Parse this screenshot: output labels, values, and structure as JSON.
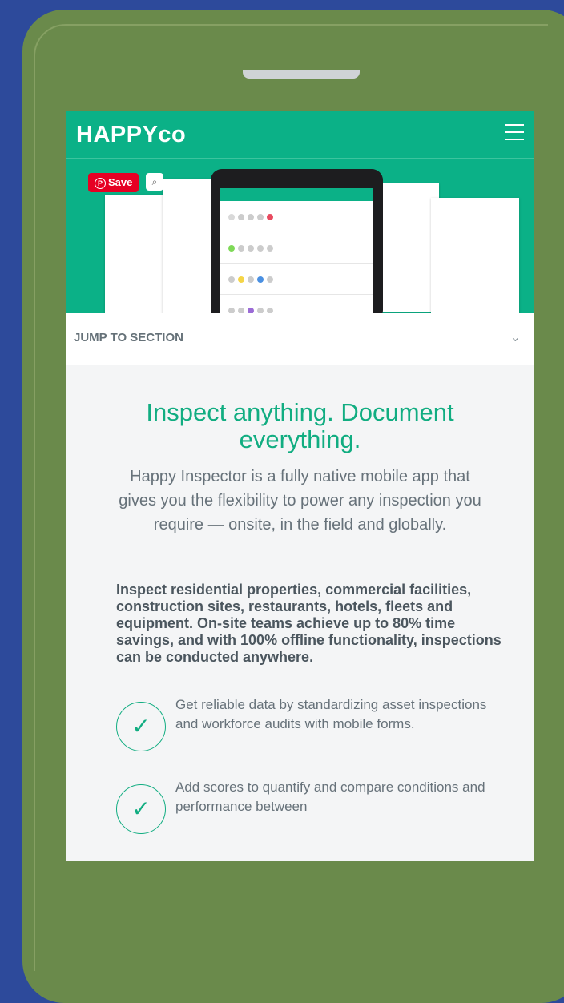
{
  "header": {
    "logo": "HAPPYco"
  },
  "hero": {
    "save_label": "Save"
  },
  "jump": {
    "label": "JUMP TO SECTION"
  },
  "main": {
    "headline": "Inspect anything. Document everything.",
    "lead": "Happy Inspector is a fully native mobile app that gives you the flexibility to power any inspection you require — onsite, in the field and globally.",
    "bold_para": "Inspect residential properties, commercial facilities, construction sites, restaurants, hotels, fleets and equipment. On-site teams achieve up to 80% time savings, and with 100% offline functionality, inspections can be conducted anywhere.",
    "features": [
      {
        "text": "Get reliable data by standardizing asset inspections and workforce audits with mobile forms."
      },
      {
        "text": "Add scores to quantify and compare conditions and performance between"
      }
    ]
  },
  "colors": {
    "brand": "#0bb187",
    "background": "#2d4a9b",
    "phone": "#6a8a4b"
  }
}
